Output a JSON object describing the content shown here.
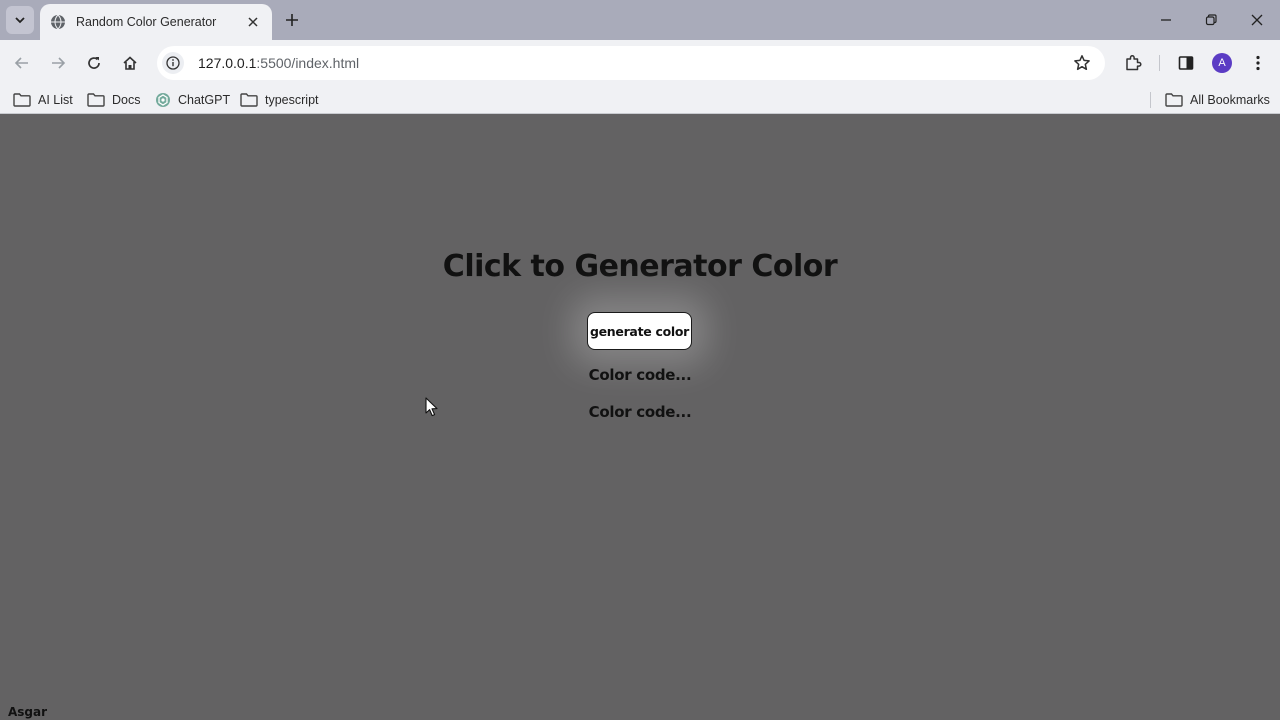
{
  "browser": {
    "tab_title": "Random Color Generator",
    "url_host": "127.0.0.1",
    "url_path": ":5500/index.html",
    "avatar_letter": "A",
    "bookmarks": [
      {
        "label": "AI List",
        "icon": "folder-icon"
      },
      {
        "label": "Docs",
        "icon": "folder-icon"
      },
      {
        "label": "ChatGPT",
        "icon": "chatgpt-icon"
      },
      {
        "label": "typescript",
        "icon": "folder-icon"
      }
    ],
    "all_bookmarks_label": "All Bookmarks"
  },
  "page": {
    "background_color": "#636263",
    "heading": "Click to Generator Color",
    "button_label": "generate color",
    "color_code_1": "Color code...",
    "color_code_2": "Color code...",
    "footer_name": "Asgar"
  }
}
